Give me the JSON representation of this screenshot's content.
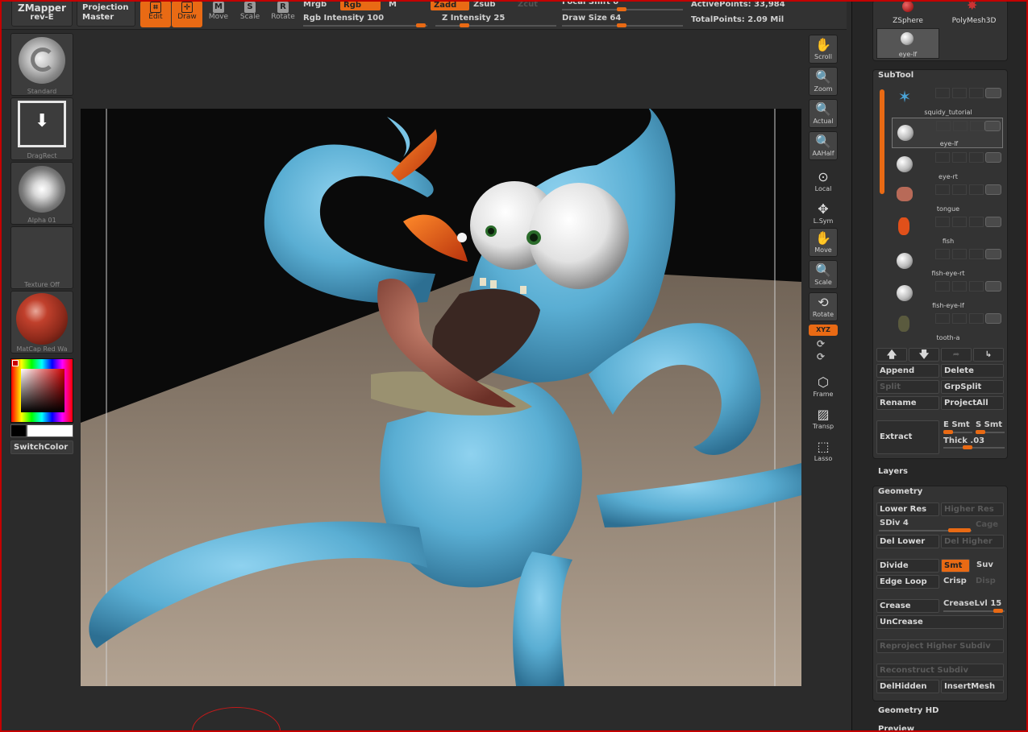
{
  "topbar": {
    "zmapper": "ZMapper",
    "zmapper_sub": "rev-E",
    "projection": "Projection",
    "projection_sub": "Master",
    "tools": [
      {
        "label": "Edit",
        "icon": "edit-icon"
      },
      {
        "label": "Draw",
        "icon": "draw-icon"
      },
      {
        "label": "Move",
        "icon": "move-icon",
        "glyph": "M"
      },
      {
        "label": "Scale",
        "icon": "scale-icon",
        "glyph": "S"
      },
      {
        "label": "Rotate",
        "icon": "rotate-icon",
        "glyph": "R"
      }
    ],
    "mrgb": "Mrgb",
    "rgb": "Rgb",
    "m": "M",
    "rgb_intensity": "Rgb  Intensity 100",
    "zadd": "Zadd",
    "zsub": "Zsub",
    "zcut": "Zcut",
    "z_intensity": "Z  Intensity 25",
    "focal_shift": "Focal Shift 0",
    "draw_size": "Draw Size 64",
    "active_points": "ActivePoints: 33,984",
    "total_points": "TotalPoints: 2.09 Mil"
  },
  "left_shelf": {
    "brush": "Standard",
    "stroke": "DragRect",
    "alpha": "Alpha 01",
    "texture": "Texture Off",
    "material": "MatCap Red Wa",
    "switch_color": "SwitchColor"
  },
  "right_tools": [
    {
      "label": "Scroll",
      "icon": "scroll-icon",
      "glyph": "✋"
    },
    {
      "label": "Zoom",
      "icon": "zoom-icon",
      "glyph": "🔍"
    },
    {
      "label": "Actual",
      "icon": "actual-icon",
      "glyph": "🔍"
    },
    {
      "label": "AAHalf",
      "icon": "aahalf-icon",
      "glyph": "🔍"
    },
    {
      "label": "Local",
      "icon": "local-icon",
      "glyph": "⊙"
    },
    {
      "label": "L.Sym",
      "icon": "lsym-icon",
      "glyph": "✥"
    },
    {
      "label": "Move",
      "icon": "move-view-icon",
      "glyph": "✋"
    },
    {
      "label": "Scale",
      "icon": "scale-view-icon",
      "glyph": "🔍"
    },
    {
      "label": "Rotate",
      "icon": "rotate-view-icon",
      "glyph": "⟲"
    },
    {
      "label": "XYZ",
      "icon": "xyz-icon"
    },
    {
      "label": "Frame",
      "icon": "frame-icon",
      "glyph": "⬡"
    },
    {
      "label": "Transp",
      "icon": "transp-icon",
      "glyph": "▨"
    },
    {
      "label": "Lasso",
      "icon": "lasso-icon",
      "glyph": "⬚"
    }
  ],
  "tool_palette": {
    "items": [
      "ZSphere",
      "PolyMesh3D",
      "eye-lf"
    ]
  },
  "subtool": {
    "title": "SubTool",
    "items": [
      "squidy_tutorial",
      "eye-lf",
      "eye-rt",
      "tongue",
      "fish",
      "fish-eye-rt",
      "fish-eye-lf",
      "tooth-a"
    ],
    "append": "Append",
    "delete": "Delete",
    "split": "Split",
    "grpsplit": "GrpSplit",
    "rename": "Rename",
    "projectall": "ProjectAll",
    "extract": "Extract",
    "e_smt": "E Smt",
    "s_smt": "S Smt",
    "thick": "Thick .03"
  },
  "layers": {
    "title": "Layers"
  },
  "geometry": {
    "title": "Geometry",
    "lower_res": "Lower Res",
    "higher_res": "Higher Res",
    "sdiv": "SDiv 4",
    "cage": "Cage",
    "del_lower": "Del Lower",
    "del_higher": "Del Higher",
    "divide": "Divide",
    "smt": "Smt",
    "suv": "Suv",
    "edge_loop": "Edge Loop",
    "crisp": "Crisp",
    "disp": "Disp",
    "crease": "Crease",
    "creaselvl": "CreaseLvl 15",
    "uncrease": "UnCrease",
    "reproject": "Reproject Higher Subdiv",
    "reconstruct": "Reconstruct Subdiv",
    "delhidden": "DelHidden",
    "insertmesh": "InsertMesh"
  },
  "geometry_hd": {
    "title": "Geometry HD"
  },
  "preview": {
    "title": "Preview"
  }
}
